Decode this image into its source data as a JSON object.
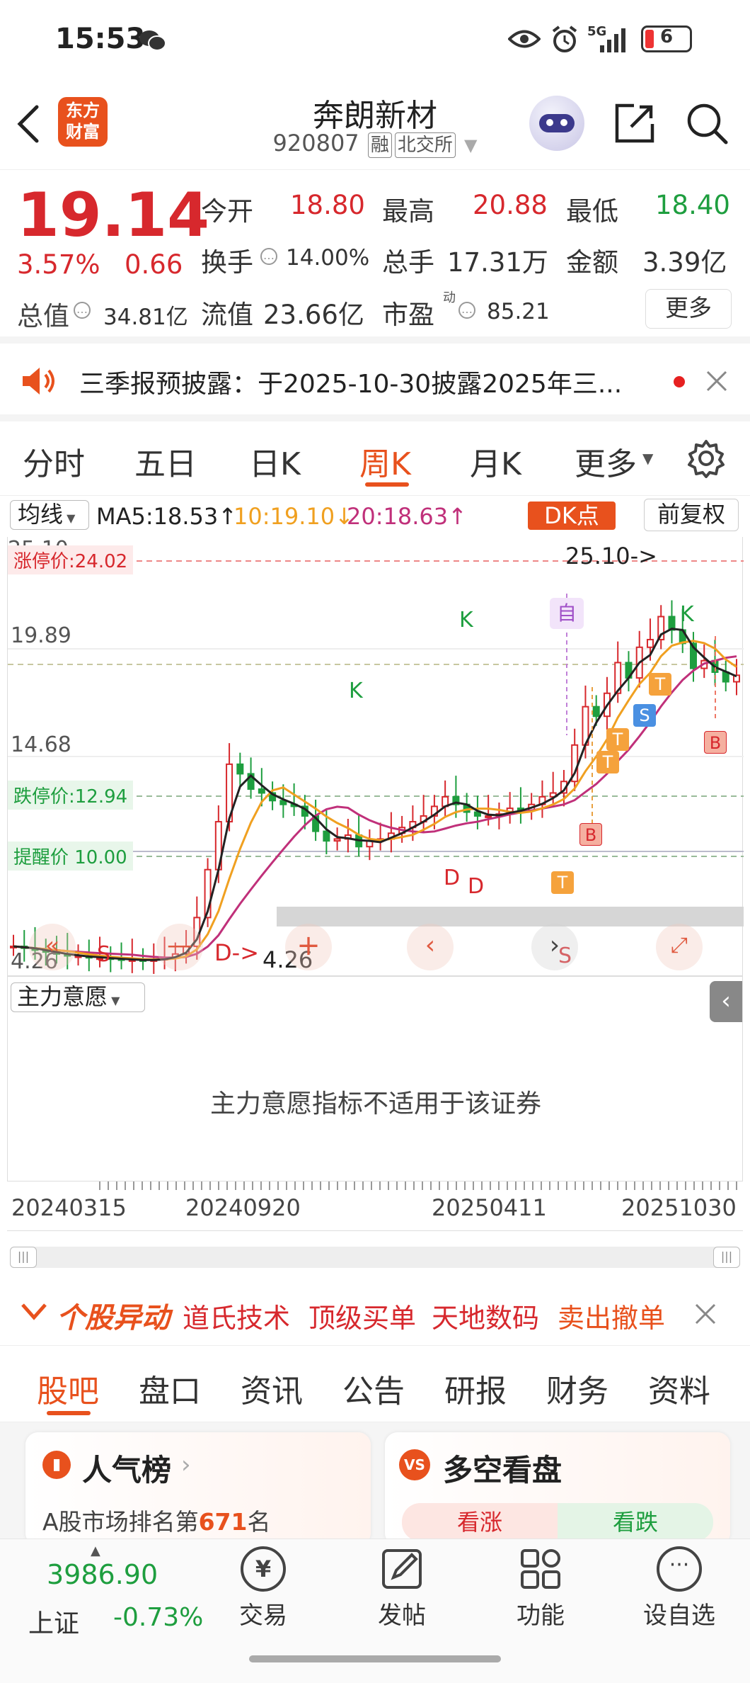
{
  "status": {
    "time": "15:53",
    "signal": "5G",
    "battery": "6"
  },
  "header": {
    "logo_text": "东方\n财富",
    "stock_name": "奔朗新材",
    "code": "920807",
    "tag1": "融",
    "tag2": "北交所"
  },
  "quote": {
    "price": "19.14",
    "change_pct": "3.57%",
    "change": "0.66",
    "open_label": "今开",
    "open": "18.80",
    "high_label": "最高",
    "high": "20.88",
    "low_label": "最低",
    "low": "18.40",
    "turnover_label": "换手",
    "turnover": "14.00%",
    "volume_label": "总手",
    "volume": "17.31万",
    "amount_label": "金额",
    "amount": "3.39亿",
    "total_cap_label": "总值",
    "total_cap": "34.81亿",
    "float_cap_label": "流值",
    "float_cap": "23.66亿",
    "pe_label": "市盈",
    "pe_sup": "动",
    "pe": "85.21",
    "more_label": "更多"
  },
  "notice": {
    "text": "三季报预披露：于2025-10-30披露2025年三..."
  },
  "period_tabs": [
    {
      "label": "分时"
    },
    {
      "label": "五日"
    },
    {
      "label": "日K"
    },
    {
      "label": "周K"
    },
    {
      "label": "月K"
    },
    {
      "label": "更多"
    }
  ],
  "chart_toolbar": {
    "ma_select": "均线",
    "ma5": "MA5:18.53↑",
    "ma10": "10:19.10↓",
    "ma20": "20:18.63↑",
    "dk_button": "DK点",
    "adjust_button": "前复权"
  },
  "chart_labels": {
    "y_top": "25.10",
    "limit_up": "涨停价:24.02",
    "y_mid1": "19.89",
    "y_mid2": "14.68",
    "limit_down": "跌停价:12.94",
    "reminder": "提醒价 10.00",
    "y_low": "4.26",
    "high_mark": "25.10->",
    "low_mark": "4.26",
    "d_arrow": "D->",
    "self_badge": "自"
  },
  "chart_data": {
    "type": "candlestick",
    "y_axis_labels": [
      "25.10",
      "19.89",
      "14.68",
      "4.26"
    ],
    "x_labels": [
      "20240315",
      "20240920",
      "20250411",
      "20251030"
    ],
    "reference_lines": [
      {
        "label": "涨停价",
        "value": 24.02
      },
      {
        "label": "跌停价",
        "value": 12.94
      },
      {
        "label": "提醒价",
        "value": 10.0
      }
    ],
    "period_high": 25.1,
    "period_low": 4.26,
    "ma": [
      {
        "name": "MA5",
        "value": 18.53,
        "color": "#222222"
      },
      {
        "name": "MA10",
        "value": 19.1,
        "color": "#f0a020"
      },
      {
        "name": "MA20",
        "value": 18.63,
        "color": "#c0307a"
      }
    ]
  },
  "indicator": {
    "select": "主力意愿",
    "message": "主力意愿指标不适用于该证券"
  },
  "ticker": {
    "title": "个股异动",
    "items": [
      {
        "text": "道氏技术",
        "color": "#d7282d"
      },
      {
        "text": "顶级买单",
        "color": "#d7282d"
      },
      {
        "text": "天地数码",
        "color": "#d7282d"
      },
      {
        "text": "卖出撤单",
        "color": "#e8511d"
      }
    ]
  },
  "section_tabs": [
    {
      "label": "股吧"
    },
    {
      "label": "盘口"
    },
    {
      "label": "资讯"
    },
    {
      "label": "公告"
    },
    {
      "label": "研报"
    },
    {
      "label": "财务"
    },
    {
      "label": "资料"
    }
  ],
  "cards": {
    "hot_title": "人气榜",
    "hot_rank_prefix": "A股市场排名第",
    "hot_rank": "671",
    "hot_rank_suffix": "名",
    "ls_title": "多空看盘",
    "bull": "看涨",
    "bear": "看跌"
  },
  "bottom": {
    "index_value": "3986.90",
    "index_name": "上证",
    "index_change": "-0.73%",
    "trade": "交易",
    "post": "发帖",
    "func": "功能",
    "watch": "设自选"
  },
  "colors": {
    "up": "#d7282d",
    "down": "#1e9e3f",
    "accent": "#e8511d"
  }
}
